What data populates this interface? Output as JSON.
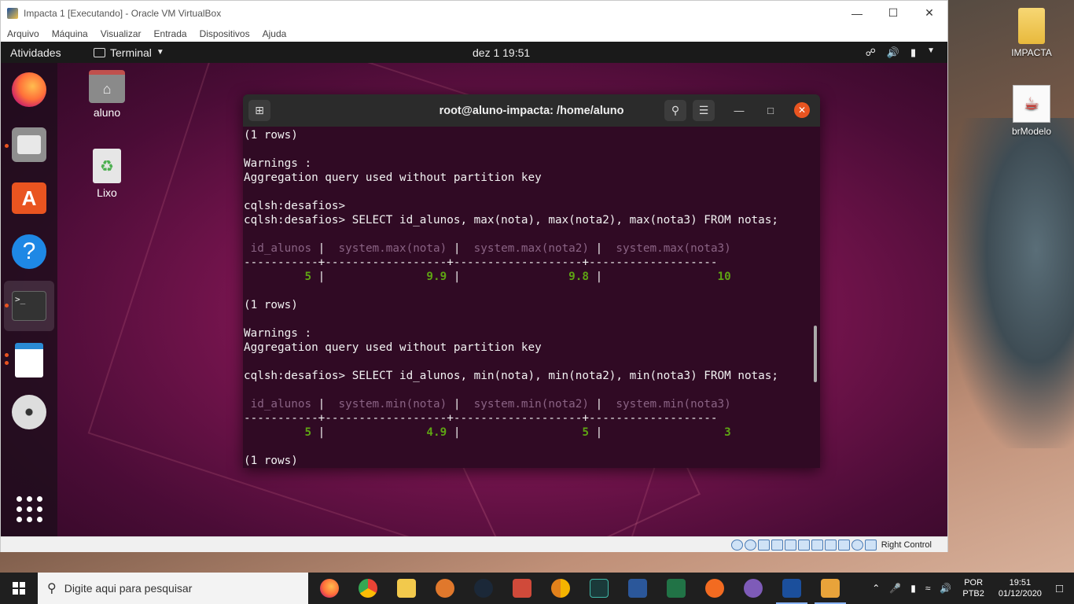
{
  "vbox": {
    "title": "Impacta 1 [Executando] - Oracle VM VirtualBox",
    "menu": [
      "Arquivo",
      "Máquina",
      "Visualizar",
      "Entrada",
      "Dispositivos",
      "Ajuda"
    ],
    "status_host_key": "Right Control"
  },
  "ubuntu": {
    "activities": "Atividades",
    "app_menu": "Terminal",
    "clock": "dez 1  19:51",
    "desktop_icons": [
      "aluno",
      "Lixo"
    ]
  },
  "windows_desktop": {
    "icons": [
      "IMPACTA",
      "brModelo"
    ]
  },
  "terminal": {
    "title": "root@aluno-impacta: /home/aluno",
    "lines": [
      {
        "type": "text",
        "text": "(1 rows)"
      },
      {
        "type": "text",
        "text": ""
      },
      {
        "type": "text",
        "text": "Warnings :"
      },
      {
        "type": "text",
        "text": "Aggregation query used without partition key"
      },
      {
        "type": "text",
        "text": ""
      },
      {
        "type": "text",
        "text": "cqlsh:desafios>"
      },
      {
        "type": "text",
        "text": "cqlsh:desafios> SELECT id_alunos, max(nota), max(nota2), max(nota3) FROM notas;"
      },
      {
        "type": "text",
        "text": ""
      },
      {
        "type": "header",
        "cells": [
          " id_alunos",
          " system.max(nota)",
          " system.max(nota2)",
          " system.max(nota3)"
        ]
      },
      {
        "type": "text",
        "text": "-----------+------------------+-------------------+-------------------"
      },
      {
        "type": "row",
        "cells": [
          "         5",
          "              9.9",
          "               9.8",
          "                10"
        ]
      },
      {
        "type": "text",
        "text": ""
      },
      {
        "type": "text",
        "text": "(1 rows)"
      },
      {
        "type": "text",
        "text": ""
      },
      {
        "type": "text",
        "text": "Warnings :"
      },
      {
        "type": "text",
        "text": "Aggregation query used without partition key"
      },
      {
        "type": "text",
        "text": ""
      },
      {
        "type": "text",
        "text": "cqlsh:desafios> SELECT id_alunos, min(nota), min(nota2), min(nota3) FROM notas;"
      },
      {
        "type": "text",
        "text": ""
      },
      {
        "type": "header",
        "cells": [
          " id_alunos",
          " system.min(nota)",
          " system.min(nota2)",
          " system.min(nota3)"
        ]
      },
      {
        "type": "text",
        "text": "-----------+------------------+-------------------+-------------------"
      },
      {
        "type": "row",
        "cells": [
          "         5",
          "              4.9",
          "                 5",
          "                 3"
        ]
      },
      {
        "type": "text",
        "text": ""
      },
      {
        "type": "text",
        "text": "(1 rows)"
      }
    ]
  },
  "taskbar": {
    "search_placeholder": "Digite aqui para pesquisar",
    "lang_top": "POR",
    "lang_bottom": "PTB2",
    "time": "19:51",
    "date": "01/12/2020"
  },
  "colors": {
    "terminal_bg": "#300a24",
    "ubuntu_orange": "#e95420",
    "cql_header": "#8a6384",
    "cql_value": "#5ea413"
  }
}
